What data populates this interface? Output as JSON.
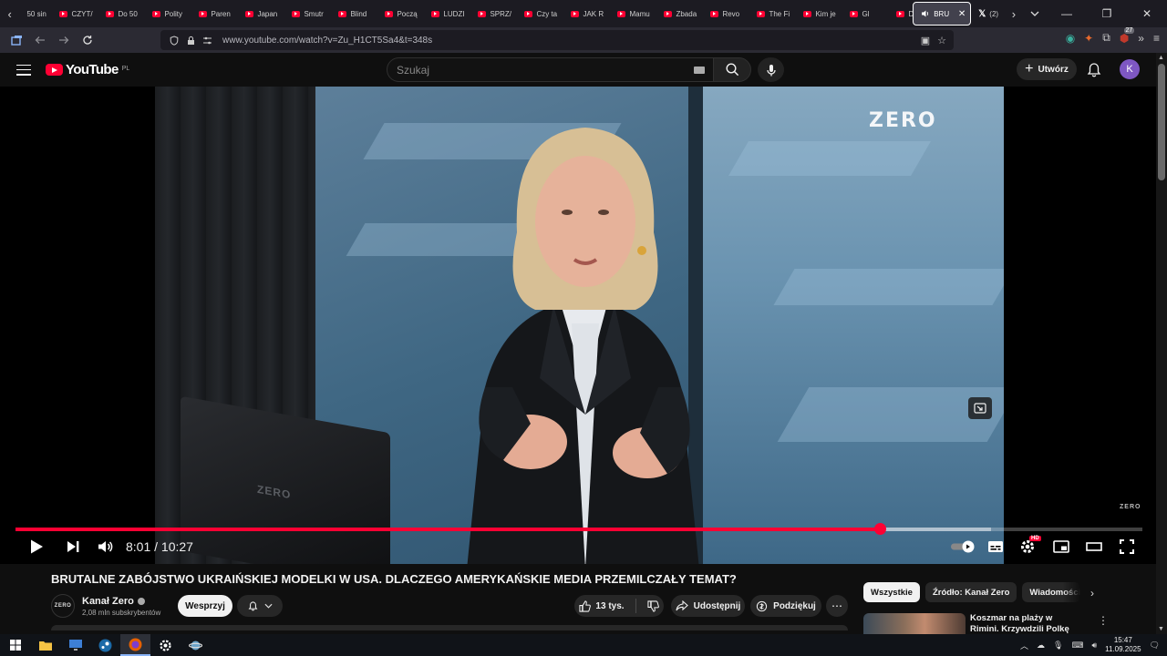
{
  "browser": {
    "tabs": [
      {
        "label": "50 sin",
        "kind": "yt"
      },
      {
        "label": "CZYT/",
        "kind": "yt"
      },
      {
        "label": "Do 50",
        "kind": "yt"
      },
      {
        "label": "Polity",
        "kind": "yt"
      },
      {
        "label": "Paren",
        "kind": "yt"
      },
      {
        "label": "Japan",
        "kind": "yt"
      },
      {
        "label": "Smutr",
        "kind": "yt"
      },
      {
        "label": "Blind",
        "kind": "yt"
      },
      {
        "label": "Począ",
        "kind": "yt"
      },
      {
        "label": "LUDZI",
        "kind": "yt"
      },
      {
        "label": "SPRZ/",
        "kind": "yt"
      },
      {
        "label": "Czy ta",
        "kind": "yt"
      },
      {
        "label": "JAK R",
        "kind": "yt"
      },
      {
        "label": "Mamu",
        "kind": "yt"
      },
      {
        "label": "Zbada",
        "kind": "yt"
      },
      {
        "label": "Revo",
        "kind": "yt"
      },
      {
        "label": "The Fi",
        "kind": "yt"
      },
      {
        "label": "Kim je",
        "kind": "yt"
      },
      {
        "label": "Gl",
        "kind": "yt"
      },
      {
        "label": "DZIEN",
        "kind": "yt"
      }
    ],
    "active_tab": {
      "label": "BRU"
    },
    "x_tab": {
      "label": "(2)"
    },
    "url": "www.youtube.com/watch?v=Zu_H1CT5Sa4&t=348s",
    "extension_badge": "27"
  },
  "youtube": {
    "logo_text": "YouTube",
    "country_code": "PL",
    "search_placeholder": "Szukaj",
    "create_label": "Utwórz",
    "avatar_letter": "K"
  },
  "player": {
    "brand_watermark": "ZERO",
    "laptop_logo": "ZERO",
    "corner_bug": "ZERO",
    "current_time": "8:01",
    "duration": "10:27",
    "time_display": "8:01 / 10:27",
    "progress_fraction": 0.767,
    "buffered_fraction": 0.866,
    "hd_badge": "HD"
  },
  "video": {
    "title": "BRUTALNE ZABÓJSTWO UKRAIŃSKIEJ MODELKI W USA. DLACZEGO AMERYKAŃSKIE MEDIA PRZEMILCZAŁY TEMAT?",
    "channel_name": "Kanał Zero",
    "channel_avatar_text": "ZERO",
    "subscribers": "2,08 mln subskrybentów",
    "support_label": "Wesprzyj",
    "likes": "13 tys.",
    "share_label": "Udostępnij",
    "thanks_label": "Podziękuj"
  },
  "sidebar": {
    "chips": [
      "Wszystkie",
      "Źródło: Kanał Zero",
      "Wiadomości z"
    ],
    "recommendation_title": "Koszmar na plaży w Rimini. Krzywdzili Polkę na oczach"
  },
  "taskbar": {
    "time": "15:47",
    "date": "11.09.2025"
  },
  "colors": {
    "accent": "#ff0033",
    "background": "#0f0f0f",
    "surface": "#272727"
  }
}
